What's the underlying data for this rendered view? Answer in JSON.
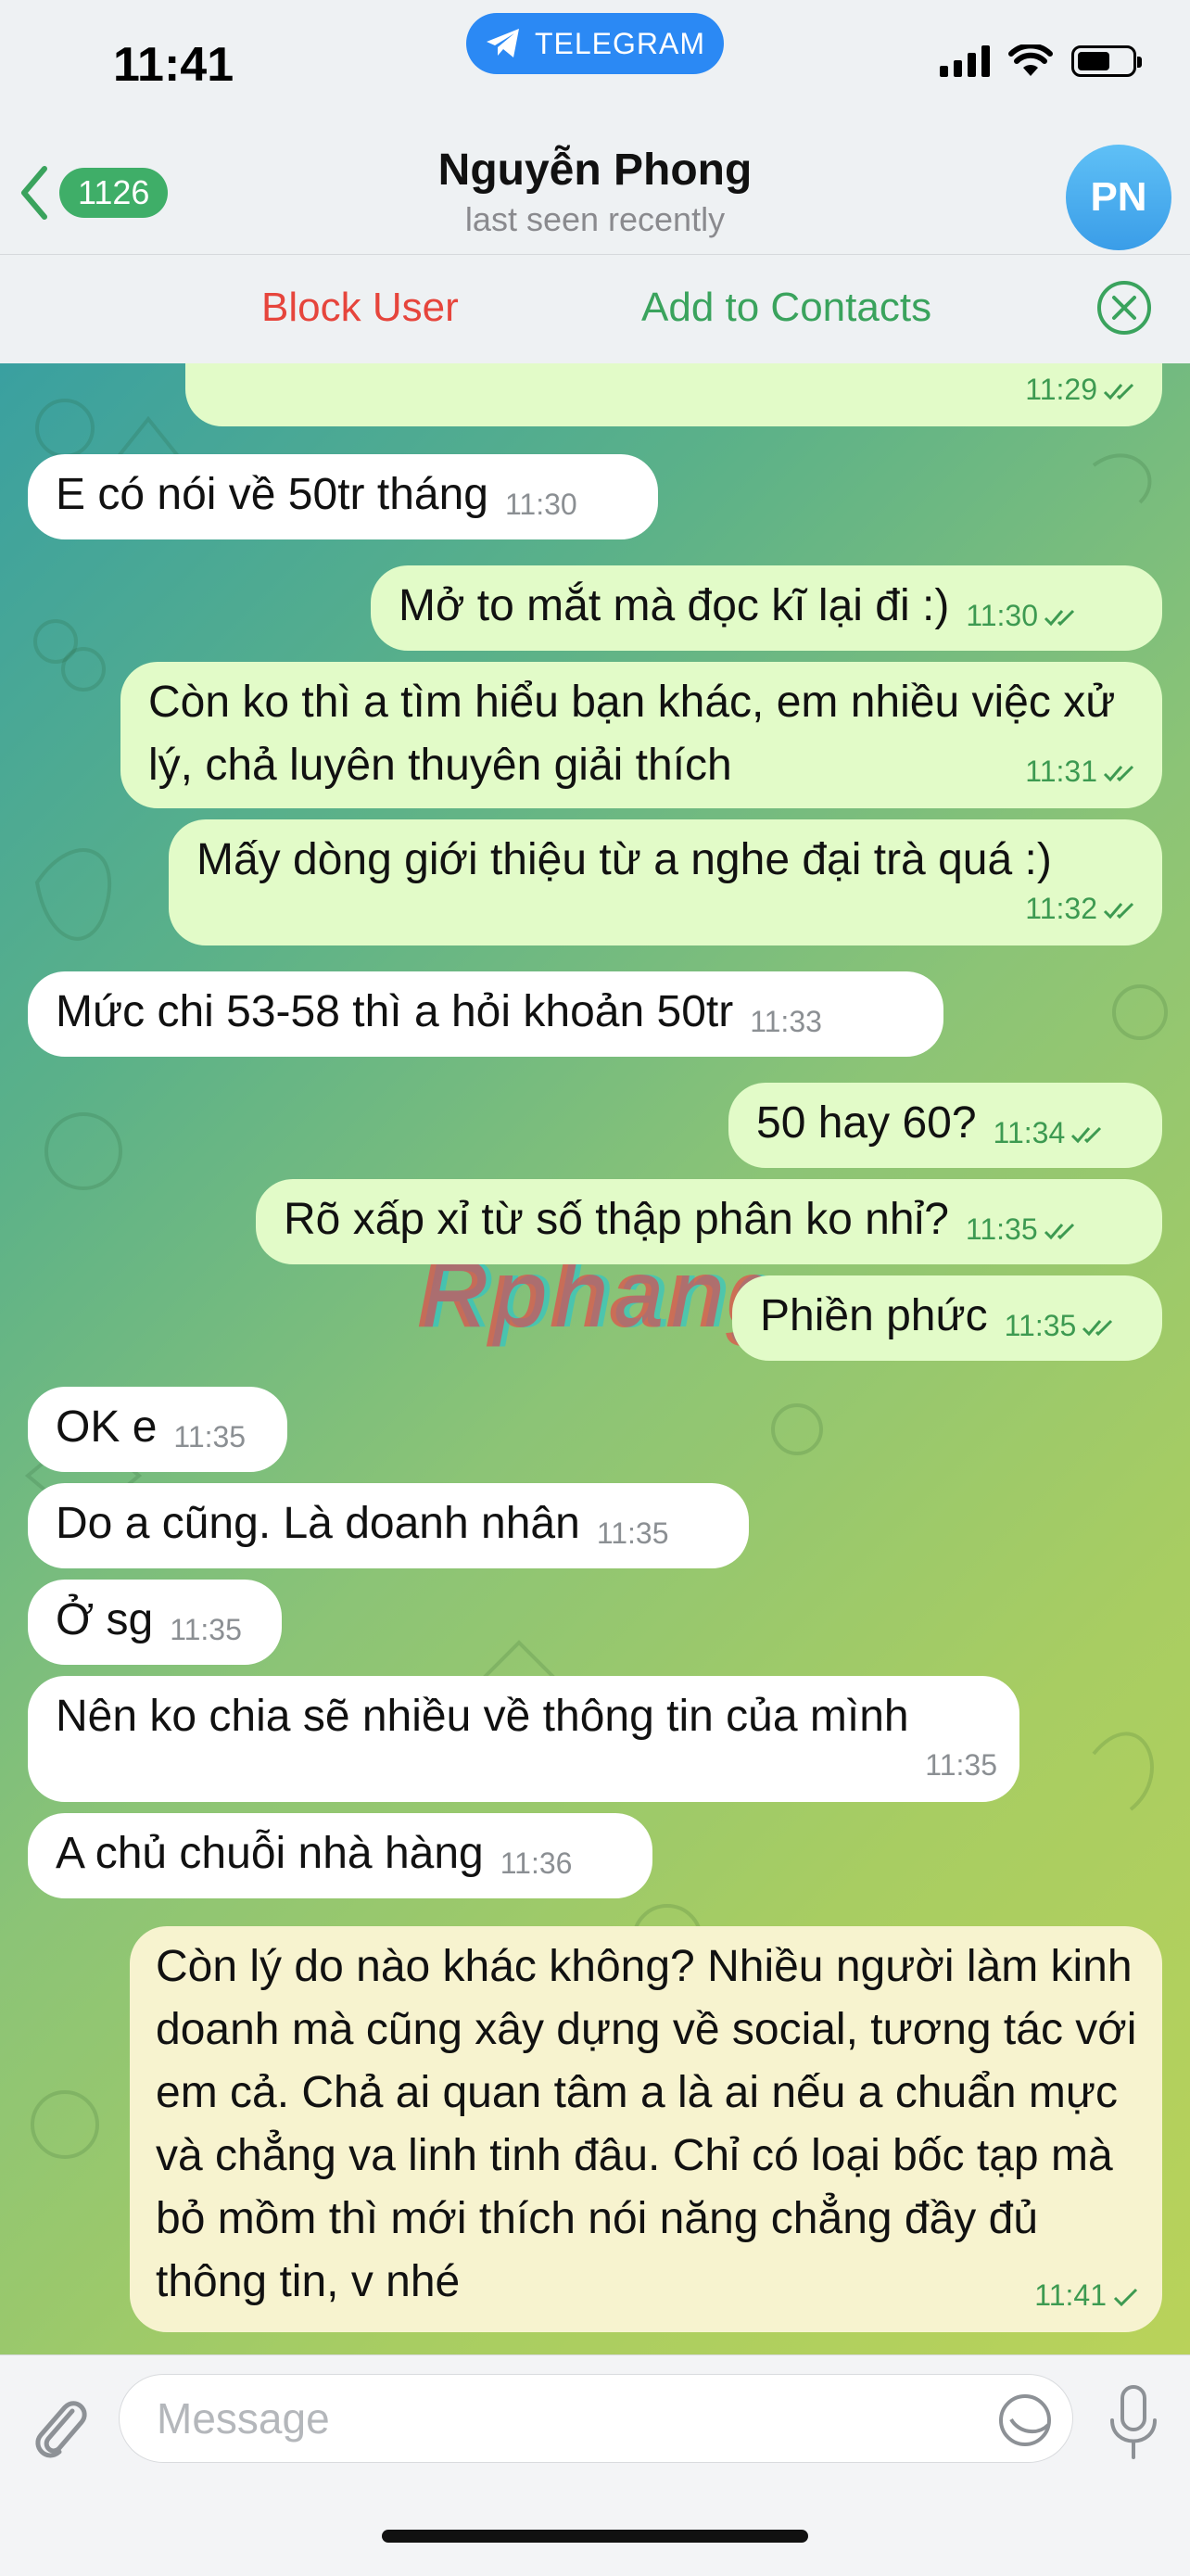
{
  "status_bar": {
    "time": "11:41",
    "pill_label": "TELEGRAM"
  },
  "header": {
    "unread_count": "1126",
    "contact_name": "Nguyễn Phong",
    "contact_status": "last seen recently",
    "avatar_initials": "PN"
  },
  "actions": {
    "block": "Block User",
    "add": "Add to Contacts"
  },
  "watermark": "Rphang",
  "messages": [
    {
      "dir": "out",
      "text": "",
      "time": "11:29",
      "read": true
    },
    {
      "dir": "in",
      "text": "E có nói về 50tr tháng",
      "time": "11:30"
    },
    {
      "dir": "out",
      "text": "Mở to mắt mà đọc kĩ lại đi :)",
      "time": "11:30",
      "read": true
    },
    {
      "dir": "out",
      "text": "Còn ko thì a tìm hiểu bạn khác, em nhiều việc xử lý, chả luyên thuyên giải thích",
      "time": "11:31",
      "read": true
    },
    {
      "dir": "out",
      "text": "Mấy dòng giới thiệu từ a nghe đại trà quá :)",
      "time": "11:32",
      "read": true
    },
    {
      "dir": "in",
      "text": "Mức chi 53-58 thì a hỏi khoản 50tr",
      "time": "11:33"
    },
    {
      "dir": "out",
      "text": "50 hay 60?",
      "time": "11:34",
      "read": true
    },
    {
      "dir": "out",
      "text": "Rõ xấp xỉ từ số thập phân ko nhỉ?",
      "time": "11:35",
      "read": true
    },
    {
      "dir": "out",
      "text": "Phiền phức",
      "time": "11:35",
      "read": true
    },
    {
      "dir": "in",
      "text": "OK e",
      "time": "11:35"
    },
    {
      "dir": "in",
      "text": "Do a cũng. Là doanh nhân",
      "time": "11:35"
    },
    {
      "dir": "in",
      "text": "Ở sg",
      "time": "11:35"
    },
    {
      "dir": "in",
      "text": "Nên ko chia sẽ nhiều về thông tin của mình",
      "time": "11:35"
    },
    {
      "dir": "in",
      "text": "A chủ chuỗi nhà hàng",
      "time": "11:36"
    },
    {
      "dir": "out",
      "text": "Còn lý do nào khác không? Nhiều người làm kinh doanh mà cũng xây dựng về social, tương tác với em cả. Chả ai quan tâm a là ai nếu a chuẩn mực và chẳng va linh tinh đâu. Chỉ có loại bốc tạp mà bỏ mồm thì mới thích nói năng chẳng đầy đủ thông tin, v nhé",
      "time": "11:41",
      "read": false
    }
  ],
  "input": {
    "placeholder": "Message"
  },
  "colors": {
    "accent": "#2b89f4",
    "outgoing_bubble": "#e2fbc8",
    "block": "#e6453c",
    "add": "#3aa35d"
  }
}
